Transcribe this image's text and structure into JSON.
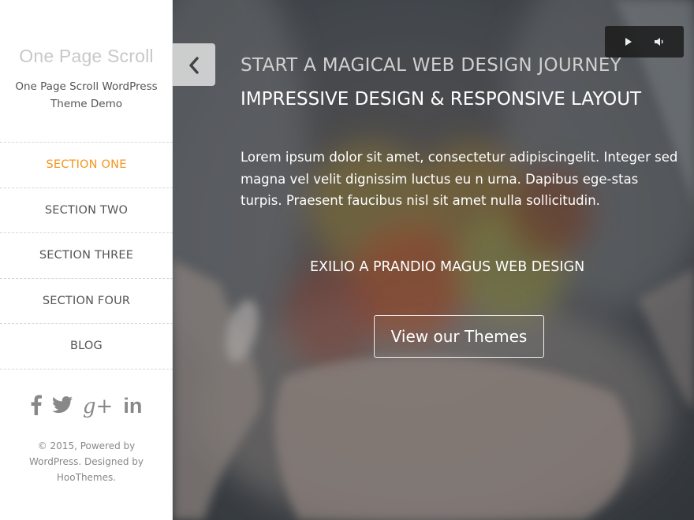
{
  "sidebar": {
    "site_title": "One Page Scroll",
    "site_description": "One Page Scroll WordPress Theme Demo",
    "nav": [
      {
        "label": "SECTION ONE",
        "active": true
      },
      {
        "label": "SECTION TWO",
        "active": false
      },
      {
        "label": "SECTION THREE",
        "active": false
      },
      {
        "label": "SECTION FOUR",
        "active": false
      },
      {
        "label": "BLOG",
        "active": false
      }
    ],
    "social": [
      {
        "icon": "facebook-icon",
        "glyph": "f"
      },
      {
        "icon": "twitter-icon",
        "glyph": "🐦"
      },
      {
        "icon": "google-plus-icon",
        "glyph": "g+"
      },
      {
        "icon": "linkedin-icon",
        "glyph": "in"
      }
    ],
    "footer": "© 2015, Powered by WordPress. Designed by HooThemes.",
    "active_color": "#f7941d"
  },
  "hero": {
    "kicker": "START A MAGICAL WEB DESIGN JOURNEY",
    "headline": "IMPRESSIVE DESIGN & RESPONSIVE LAYOUT",
    "body": "Lorem ipsum dolor sit amet, consectetur adipiscingelit. Integer sed magna vel velit dignissim luctus eu n urna. Dapibus ege-stas turpis. Praesent faucibus nisl sit amet nulla sollicitudin.",
    "tagline": "EXILIO A PRANDIO MAGUS WEB DESIGN",
    "cta_label": "View our Themes"
  },
  "controls": {
    "toggle_icon": "chevron-left-icon",
    "play_icon": "play-icon",
    "volume_icon": "volume-icon"
  }
}
